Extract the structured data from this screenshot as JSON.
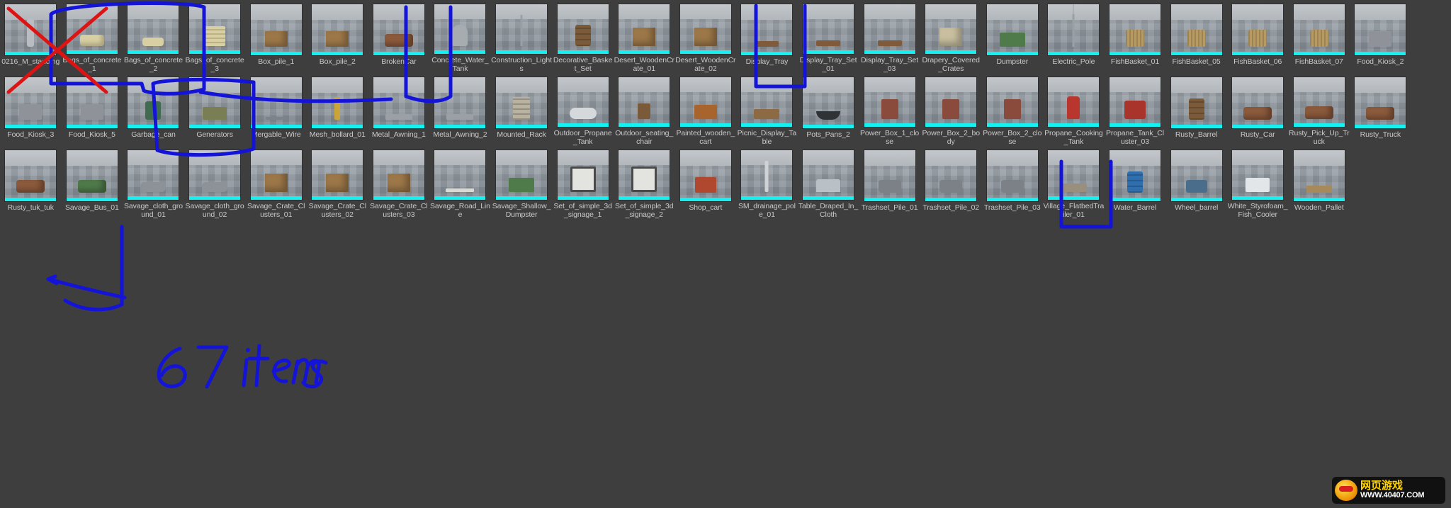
{
  "app": {
    "type": "3d-asset-thumbnail-browser",
    "background_color": "#3e3e3e",
    "tile_accent_color": "#16f0f0",
    "label_color": "#c9c9c9"
  },
  "annotation": {
    "ink_color": "#1414d8",
    "strike_color": "#dd1414",
    "handwritten_note": "67 items",
    "struck_out_item": "0216_M_standing",
    "highlighted_groups": [
      "Bags_of_concrete_1 / Bags_of_concrete_2 / Bags_of_concrete_3",
      "Construction_Lights",
      "Drapery_Covered_Crates",
      "Garbage_can / Generators",
      "Wheel_barrel",
      "Wooden_Pallet"
    ]
  },
  "watermark": {
    "chinese_text": "网页游戏",
    "url_text": "WWW.40407.COM"
  },
  "grid": {
    "columns": 23,
    "total_items": 67,
    "items": [
      {
        "label": "0216_M_standing",
        "icon": "person-icon",
        "struck": true,
        "marked": false
      },
      {
        "label": "Bags_of_concrete_1",
        "icon": "bag-icon",
        "struck": false,
        "marked": true
      },
      {
        "label": "Bags_of_concrete_2",
        "icon": "bags-pile-icon",
        "struck": false,
        "marked": true
      },
      {
        "label": "Bags_of_concrete_3",
        "icon": "bags-stack-icon",
        "struck": false,
        "marked": true
      },
      {
        "label": "Box_pile_1",
        "icon": "box-icon",
        "struck": false,
        "marked": false
      },
      {
        "label": "Box_pile_2",
        "icon": "box-icon",
        "struck": false,
        "marked": false
      },
      {
        "label": "BrokenCar",
        "icon": "car-icon",
        "struck": false,
        "marked": false
      },
      {
        "label": "Concrete_Water_Tank",
        "icon": "tank-icon",
        "struck": false,
        "marked": false
      },
      {
        "label": "Construction_Lights",
        "icon": "light-pole-icon",
        "struck": false,
        "marked": true
      },
      {
        "label": "Decorative_Basket_Set",
        "icon": "barrel-icon",
        "struck": false,
        "marked": false
      },
      {
        "label": "Desert_WoodenCrate_01",
        "icon": "crate-icon",
        "struck": false,
        "marked": false
      },
      {
        "label": "Desert_WoodenCrate_02",
        "icon": "crate-icon",
        "struck": false,
        "marked": false
      },
      {
        "label": "Display_Tray",
        "icon": "tray-icon",
        "struck": false,
        "marked": false
      },
      {
        "label": "Display_Tray_Set_01",
        "icon": "tray-set-icon",
        "struck": false,
        "marked": false
      },
      {
        "label": "Display_Tray_Set_03",
        "icon": "tray-set-icon",
        "struck": false,
        "marked": false
      },
      {
        "label": "Drapery_Covered_Crates",
        "icon": "covered-crate-icon",
        "struck": false,
        "marked": true
      },
      {
        "label": "Dumpster",
        "icon": "dumpster-icon",
        "struck": false,
        "marked": false
      },
      {
        "label": "Electric_Pole",
        "icon": "pole-icon",
        "struck": false,
        "marked": false
      },
      {
        "label": "FishBasket_01",
        "icon": "basket-icon",
        "struck": false,
        "marked": false
      },
      {
        "label": "FishBasket_05",
        "icon": "basket-icon",
        "struck": false,
        "marked": false
      },
      {
        "label": "FishBasket_06",
        "icon": "basket-icon",
        "struck": false,
        "marked": false
      },
      {
        "label": "FishBasket_07",
        "icon": "basket-icon",
        "struck": false,
        "marked": false
      },
      {
        "label": "Food_Kiosk_2",
        "icon": "kiosk-icon",
        "struck": false,
        "marked": false
      },
      {
        "label": "Food_Kiosk_3",
        "icon": "kiosk-icon",
        "struck": false,
        "marked": false
      },
      {
        "label": "Food_Kiosk_5",
        "icon": "kiosk-icon",
        "struck": false,
        "marked": false
      },
      {
        "label": "Garbage_can",
        "icon": "garbage-can-icon",
        "struck": false,
        "marked": true
      },
      {
        "label": "Generators",
        "icon": "generator-icon",
        "struck": false,
        "marked": true
      },
      {
        "label": "Mergable_Wire",
        "icon": "wire-icon",
        "struck": false,
        "marked": false
      },
      {
        "label": "Mesh_bollard_01",
        "icon": "bollard-icon",
        "struck": false,
        "marked": false
      },
      {
        "label": "Metal_Awning_1",
        "icon": "awning-icon",
        "struck": false,
        "marked": false
      },
      {
        "label": "Metal_Awning_2",
        "icon": "awning-icon",
        "struck": false,
        "marked": false
      },
      {
        "label": "Mounted_Rack",
        "icon": "rack-icon",
        "struck": false,
        "marked": false
      },
      {
        "label": "Outdoor_Propane_Tank",
        "icon": "propane-tank-icon",
        "struck": false,
        "marked": false
      },
      {
        "label": "Outdoor_seating_chair",
        "icon": "chair-icon",
        "struck": false,
        "marked": false
      },
      {
        "label": "Painted_wooden_cart",
        "icon": "cart-icon",
        "struck": false,
        "marked": false
      },
      {
        "label": "Picnic_Display_Table",
        "icon": "table-icon",
        "struck": false,
        "marked": false
      },
      {
        "label": "Pots_Pans_2",
        "icon": "pot-icon",
        "struck": false,
        "marked": false
      },
      {
        "label": "Power_Box_1_close",
        "icon": "power-box-icon",
        "struck": false,
        "marked": false
      },
      {
        "label": "Power_Box_2_body",
        "icon": "power-box-icon",
        "struck": false,
        "marked": false
      },
      {
        "label": "Power_Box_2_close",
        "icon": "power-box-icon",
        "struck": false,
        "marked": false
      },
      {
        "label": "Propane_Cooking_Tank",
        "icon": "propane-bottle-icon",
        "struck": false,
        "marked": false
      },
      {
        "label": "Propane_Tank_Cluster_03",
        "icon": "propane-cluster-icon",
        "struck": false,
        "marked": false
      },
      {
        "label": "Rusty_Barrel",
        "icon": "barrel-icon",
        "struck": false,
        "marked": false
      },
      {
        "label": "Rusty_Car",
        "icon": "car-icon",
        "struck": false,
        "marked": false
      },
      {
        "label": "Rusty_Pick_Up_Truck",
        "icon": "truck-icon",
        "struck": false,
        "marked": false
      },
      {
        "label": "Rusty_Truck",
        "icon": "truck-icon",
        "struck": false,
        "marked": false
      },
      {
        "label": "Rusty_tuk_tuk",
        "icon": "tuktuk-icon",
        "struck": false,
        "marked": false
      },
      {
        "label": "Savage_Bus_01",
        "icon": "bus-icon",
        "struck": false,
        "marked": false
      },
      {
        "label": "Savage_cloth_ground_01",
        "icon": "cloth-icon",
        "struck": false,
        "marked": false
      },
      {
        "label": "Savage_cloth_ground_02",
        "icon": "cloth-icon",
        "struck": false,
        "marked": false
      },
      {
        "label": "Savage_Crate_Clusters_01",
        "icon": "crate-cluster-icon",
        "struck": false,
        "marked": false
      },
      {
        "label": "Savage_Crate_Clusters_02",
        "icon": "crate-cluster-icon",
        "struck": false,
        "marked": false
      },
      {
        "label": "Savage_Crate_Clusters_03",
        "icon": "crate-cluster-icon",
        "struck": false,
        "marked": false
      },
      {
        "label": "Savage_Road_Line",
        "icon": "road-line-icon",
        "struck": false,
        "marked": false
      },
      {
        "label": "Savage_Shallow_Dumpster",
        "icon": "dumpster-icon",
        "struck": false,
        "marked": false
      },
      {
        "label": "Set_of_simple_3d_signage_1",
        "icon": "signage-icon",
        "struck": false,
        "marked": false
      },
      {
        "label": "Set_of_simple_3d_signage_2",
        "icon": "signage-icon",
        "struck": false,
        "marked": false
      },
      {
        "label": "Shop_cart",
        "icon": "shop-cart-icon",
        "struck": false,
        "marked": false
      },
      {
        "label": "SM_drainage_pole_01",
        "icon": "drain-pole-icon",
        "struck": false,
        "marked": false
      },
      {
        "label": "Table_Draped_In_Cloth",
        "icon": "draped-table-icon",
        "struck": false,
        "marked": false
      },
      {
        "label": "Trashset_Pile_01",
        "icon": "trash-pile-icon",
        "struck": false,
        "marked": false
      },
      {
        "label": "Trashset_Pile_02",
        "icon": "trash-pile-icon",
        "struck": false,
        "marked": false
      },
      {
        "label": "Trashset_Pile_03",
        "icon": "trash-pile-icon",
        "struck": false,
        "marked": false
      },
      {
        "label": "Village_FlatbedTrailer_01",
        "icon": "trailer-icon",
        "struck": false,
        "marked": false
      },
      {
        "label": "Water_Barrel",
        "icon": "water-barrel-icon",
        "struck": false,
        "marked": false
      },
      {
        "label": "Wheel_barrel",
        "icon": "wheelbarrow-icon",
        "struck": false,
        "marked": true
      },
      {
        "label": "White_Styrofoam_Fish_Cooler",
        "icon": "cooler-icon",
        "struck": false,
        "marked": false
      },
      {
        "label": "Wooden_Pallet",
        "icon": "pallet-icon",
        "struck": false,
        "marked": true
      }
    ]
  }
}
